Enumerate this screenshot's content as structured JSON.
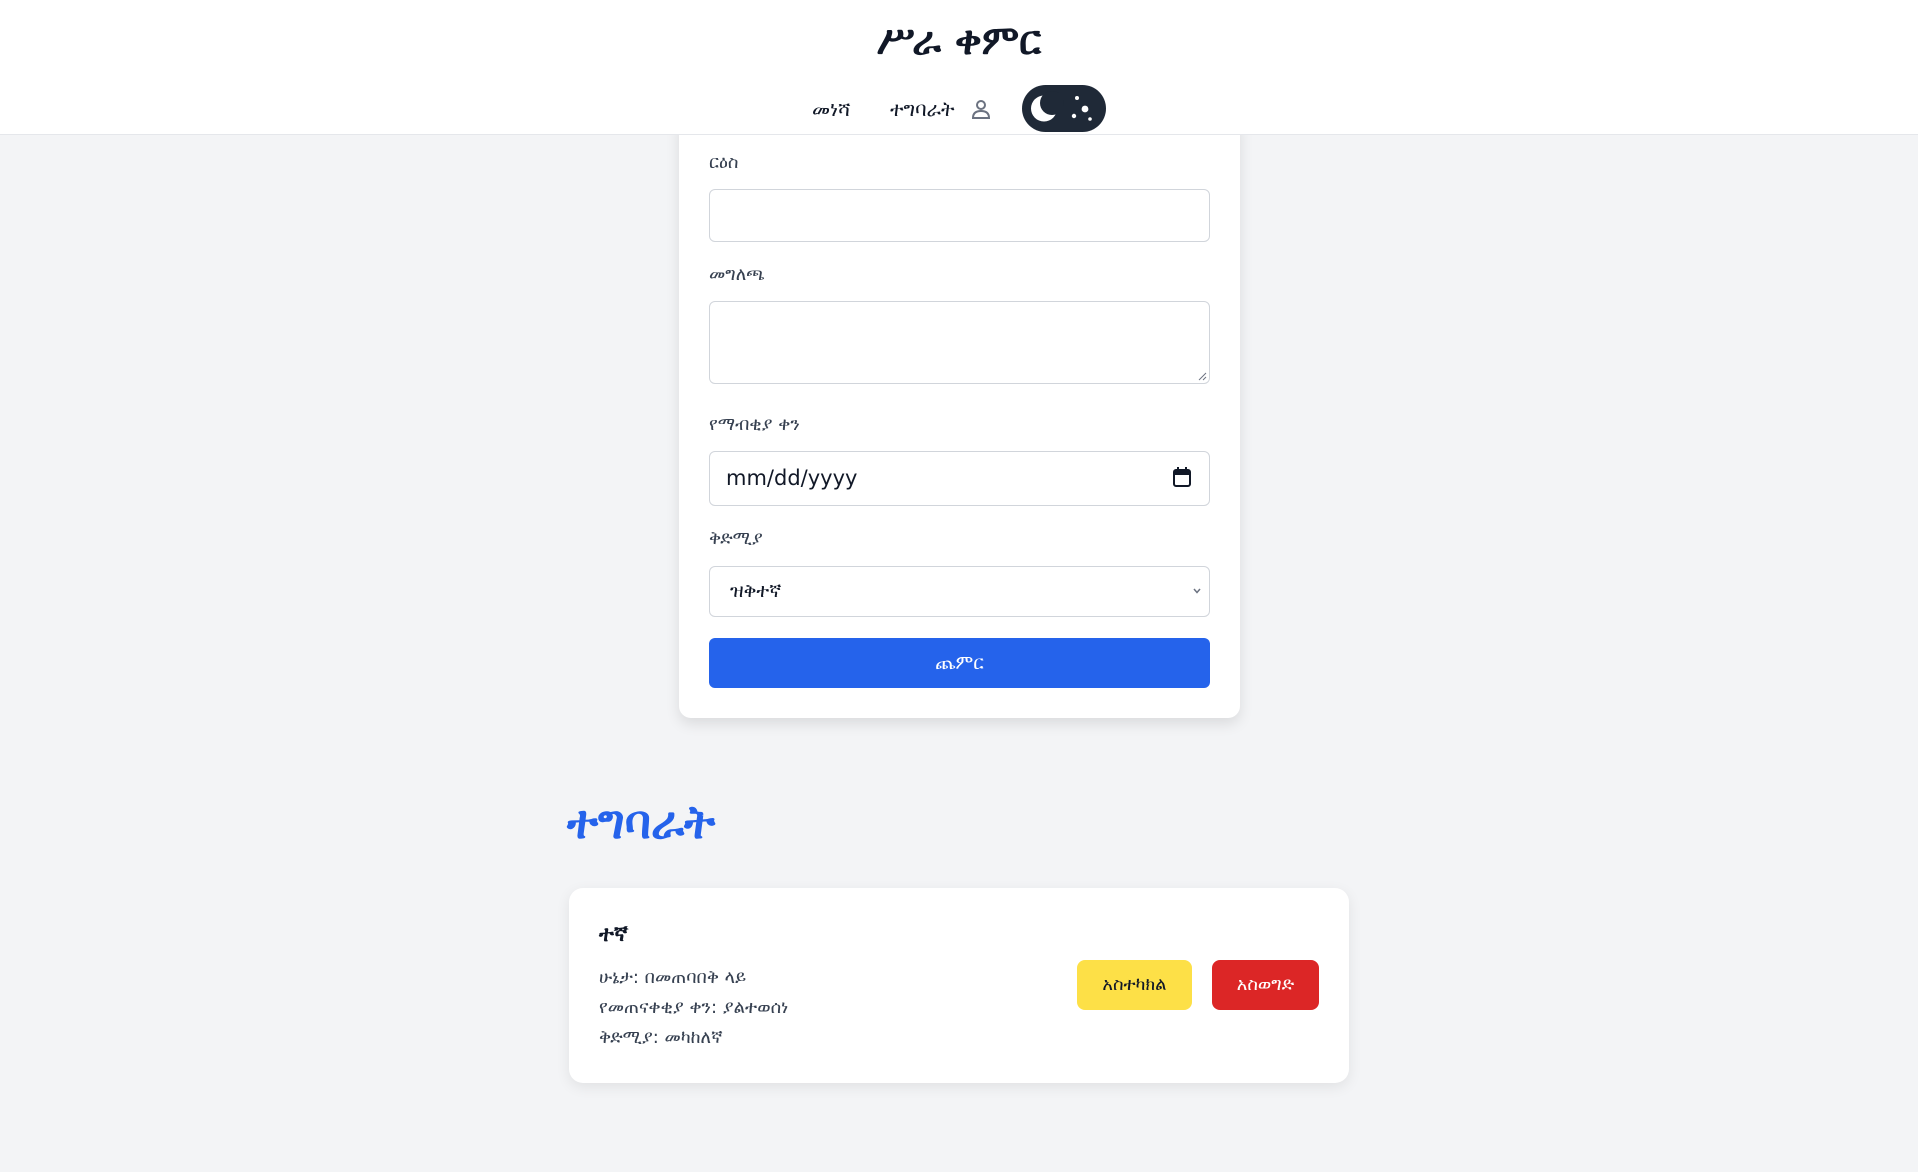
{
  "header": {
    "title": "ሥራ ቀምር",
    "nav": {
      "home_label": "መነሻ",
      "tasks_label": "ተግባራት",
      "user_icon": "user-icon",
      "theme_toggle_icon": "moon-stars-icon"
    }
  },
  "form": {
    "title_label": "ርዕስ",
    "title_value": "",
    "description_label": "መግለጫ",
    "description_value": "",
    "due_date_label": "የማብቂያ ቀን",
    "due_date_placeholder": "mm/dd/yyyy",
    "priority_label": "ቅድሚያ",
    "priority_selected": "ዝቅተኛ",
    "submit_label": "ጨምር"
  },
  "tasks": {
    "heading": "ተግባራት",
    "items": [
      {
        "title": "ተኛ",
        "status": "ሁኔታ: በመጠባበቅ ላይ",
        "due": "የመጠናቀቂያ ቀን: ያልተወሰነ",
        "priority": "ቅድሚያ: መካከለኛ",
        "edit_label": "አስተካክል",
        "delete_label": "አስወግድ"
      }
    ]
  },
  "colors": {
    "primary": "#2563eb",
    "edit": "#fde047",
    "delete": "#dc2626",
    "background": "#f3f4f6",
    "toggle": "#1f2937"
  }
}
